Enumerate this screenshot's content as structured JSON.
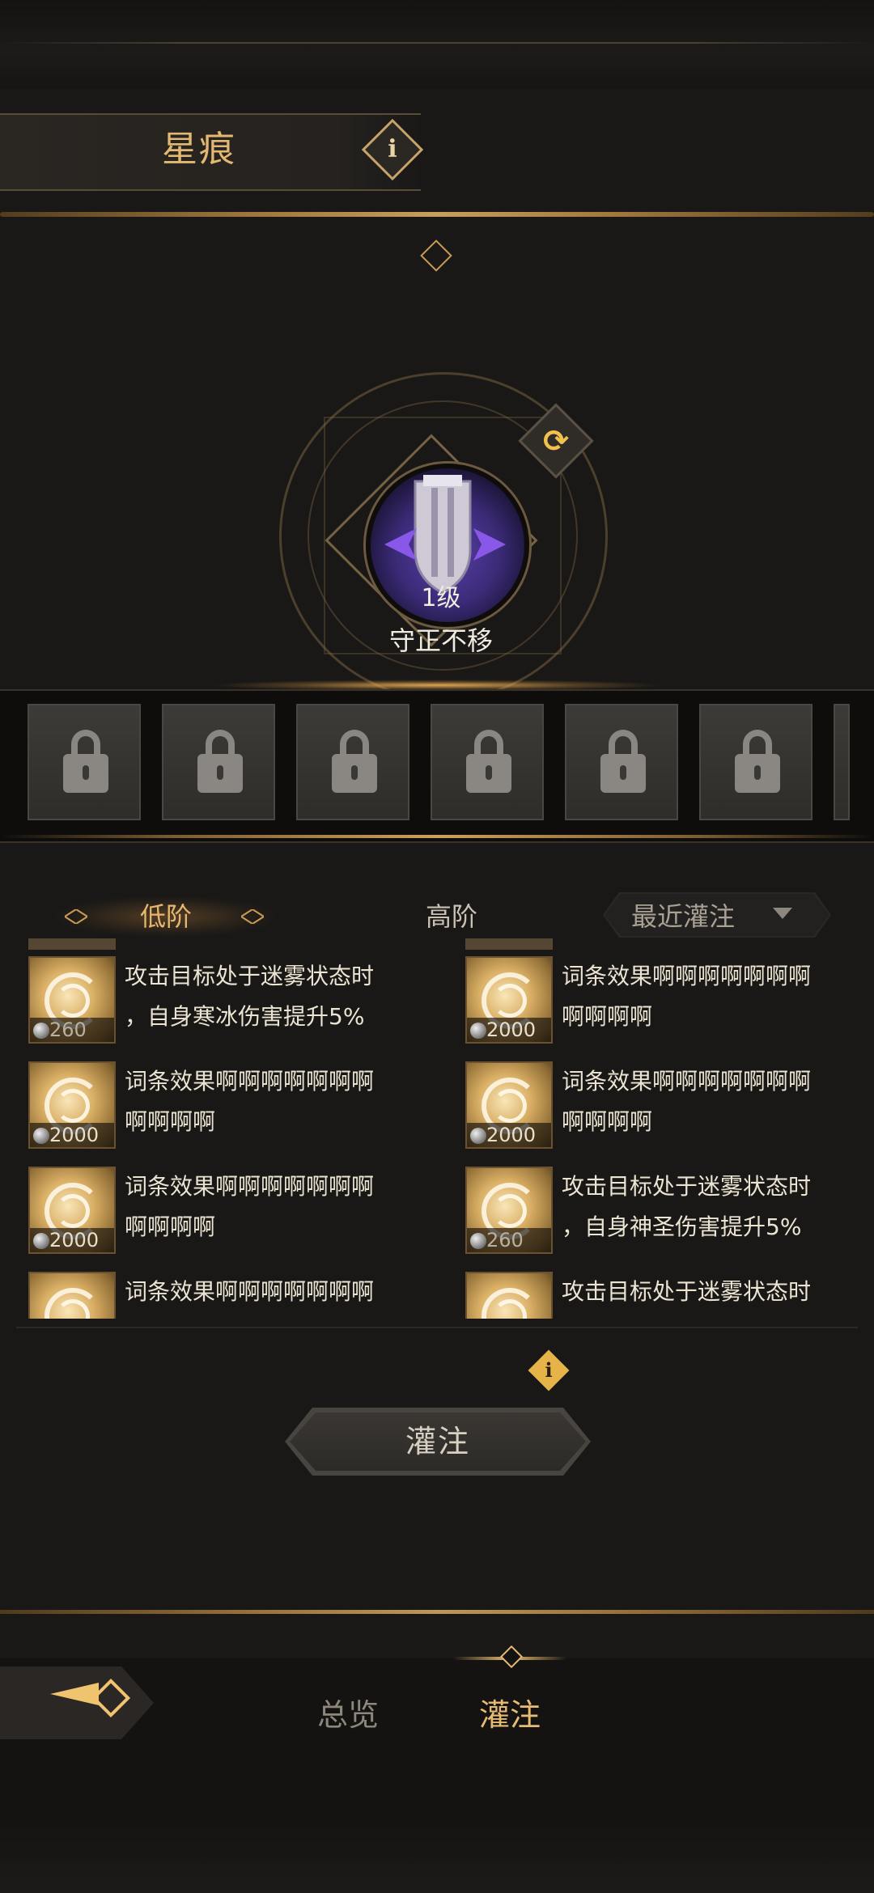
{
  "header": {
    "title": "星痕",
    "info_icon": "info-icon"
  },
  "emblem": {
    "level": "1级",
    "name": "守正不移",
    "swap_icon": "swap-icon"
  },
  "slots": {
    "count": 6,
    "icon": "lock-icon",
    "locked": true
  },
  "tabs": {
    "low": "低阶",
    "high": "高阶",
    "sort": "最近灌注"
  },
  "items": [
    {
      "col": 0,
      "row": 0,
      "desc": "攻击目标处于迷雾状态时\n，自身寒冰伤害提升5%",
      "cost": "260"
    },
    {
      "col": 1,
      "row": 0,
      "desc": "词条效果啊啊啊啊啊啊啊\n啊啊啊啊",
      "cost": "2000"
    },
    {
      "col": 0,
      "row": 1,
      "desc": "词条效果啊啊啊啊啊啊啊\n啊啊啊啊",
      "cost": "2000"
    },
    {
      "col": 1,
      "row": 1,
      "desc": "词条效果啊啊啊啊啊啊啊\n啊啊啊啊",
      "cost": "2000"
    },
    {
      "col": 0,
      "row": 2,
      "desc": "词条效果啊啊啊啊啊啊啊\n啊啊啊啊",
      "cost": "2000"
    },
    {
      "col": 1,
      "row": 2,
      "desc": "攻击目标处于迷雾状态时\n，自身神圣伤害提升5%",
      "cost": "260"
    },
    {
      "col": 0,
      "row": 3,
      "desc": "词条效果啊啊啊啊啊啊啊",
      "cost": ""
    },
    {
      "col": 1,
      "row": 3,
      "desc": "攻击目标处于迷雾状态时",
      "cost": ""
    }
  ],
  "action": {
    "infuse_label": "灌注",
    "note_icon": "info-icon"
  },
  "bottom_nav": {
    "overview": "总览",
    "infuse": "灌注",
    "active": "infuse"
  },
  "colors": {
    "gold": "#e3b873",
    "bg": "#191817",
    "emblem_purple": "#5a3ea8"
  }
}
